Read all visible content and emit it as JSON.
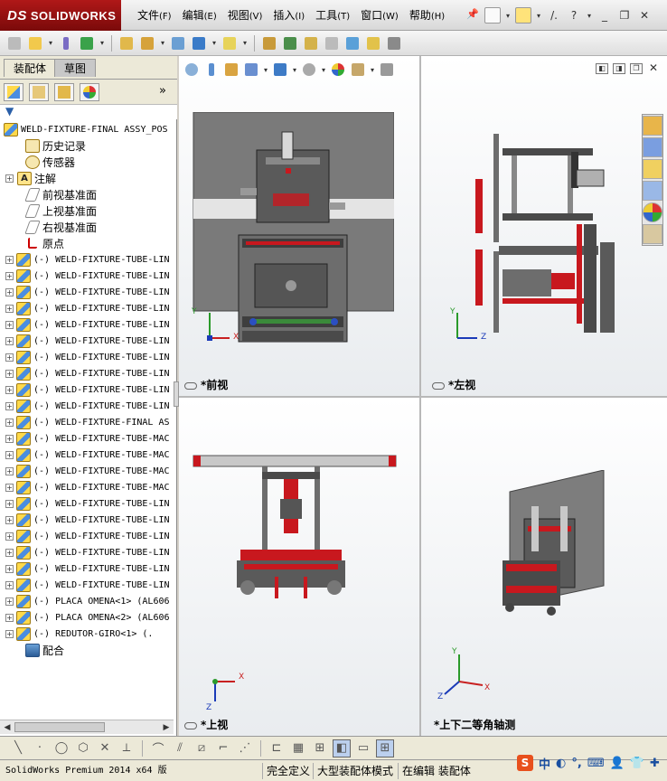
{
  "app": {
    "logo_text": "SOLIDWORKS",
    "logo_ds": "DS"
  },
  "menu": [
    {
      "label": "文件",
      "key": "(F)"
    },
    {
      "label": "编辑",
      "key": "(E)"
    },
    {
      "label": "视图",
      "key": "(V)"
    },
    {
      "label": "插入",
      "key": "(I)"
    },
    {
      "label": "工具",
      "key": "(T)"
    },
    {
      "label": "窗口",
      "key": "(W)"
    },
    {
      "label": "帮助",
      "key": "(H)"
    }
  ],
  "left_panel": {
    "tabs": [
      "装配体",
      "草图"
    ],
    "top_item": "WELD-FIXTURE-FINAL ASSY_POS",
    "items": [
      {
        "label": "历史记录",
        "icon": "history-icon",
        "expand": false
      },
      {
        "label": "传感器",
        "icon": "sensor-icon",
        "expand": false
      },
      {
        "label": "注解",
        "icon": "annotation-icon",
        "expand": true
      },
      {
        "label": "前视基准面",
        "icon": "plane-icon",
        "expand": false
      },
      {
        "label": "上视基准面",
        "icon": "plane-icon",
        "expand": false
      },
      {
        "label": "右视基准面",
        "icon": "plane-icon",
        "expand": false
      },
      {
        "label": "原点",
        "icon": "origin-icon",
        "expand": false
      }
    ],
    "components": [
      "(-) WELD-FIXTURE-TUBE-LIN",
      "(-) WELD-FIXTURE-TUBE-LIN",
      "(-) WELD-FIXTURE-TUBE-LIN",
      "(-) WELD-FIXTURE-TUBE-LIN",
      "(-) WELD-FIXTURE-TUBE-LIN",
      "(-) WELD-FIXTURE-TUBE-LIN",
      "(-) WELD-FIXTURE-TUBE-LIN",
      "(-) WELD-FIXTURE-TUBE-LIN",
      "(-) WELD-FIXTURE-TUBE-LIN",
      "(-) WELD-FIXTURE-TUBE-LIN",
      "(-) WELD-FIXTURE-FINAL AS",
      "(-) WELD-FIXTURE-TUBE-MAC",
      "(-) WELD-FIXTURE-TUBE-MAC",
      "(-) WELD-FIXTURE-TUBE-MAC",
      "(-) WELD-FIXTURE-TUBE-MAC",
      "(-) WELD-FIXTURE-TUBE-LIN",
      "(-) WELD-FIXTURE-TUBE-LIN",
      "(-) WELD-FIXTURE-TUBE-LIN",
      "(-) WELD-FIXTURE-TUBE-LIN",
      "(-) WELD-FIXTURE-TUBE-LIN",
      "(-) WELD-FIXTURE-TUBE-LIN",
      "(-) PLACA OMENA<1> (AL606",
      "(-) PLACA OMENA<2> (AL606",
      "(-) REDUTOR-GIRO<1> (."
    ],
    "mates_label": "配合"
  },
  "viewports": {
    "front": "*前视",
    "left": "*左视",
    "top": "*上视",
    "iso": "*上下二等角轴测"
  },
  "triad": {
    "x": "X",
    "y": "Y",
    "z": "Z"
  },
  "status": {
    "app": "SolidWorks Premium 2014 x64 版",
    "s1": "完全定义",
    "s2": "大型装配体模式",
    "s3": "在编辑 装配体"
  },
  "ime": {
    "s": "S",
    "zh": "中"
  },
  "colors": {
    "accent_red": "#c8181e",
    "panel": "#ece9d8",
    "steel": "#6d6d6d"
  }
}
